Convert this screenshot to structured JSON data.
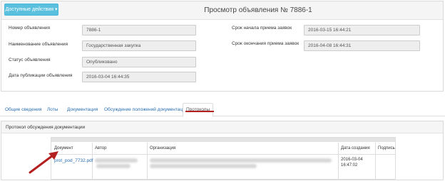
{
  "header": {
    "actions_button": "Доступные действия ▾",
    "title": "Просмотр объявления № 7886-1"
  },
  "fields": {
    "number": {
      "label": "Номер объявления",
      "value": "7886-1"
    },
    "name": {
      "label": "Наименование объявления",
      "value": "Государственная закупка"
    },
    "status": {
      "label": "Статус объявления",
      "value": "Опубликовано"
    },
    "publish_date": {
      "label": "Дата публикации объявления",
      "value": "2016-03-04 16:44:35"
    },
    "start_date": {
      "label": "Срок начала приема заявок",
      "value": "2016-03-15 16:44:21"
    },
    "end_date": {
      "label": "Срок окончания приема заявок",
      "value": "2016-04-08 16:44:31"
    }
  },
  "tabs": [
    {
      "label": "Общие сведения"
    },
    {
      "label": "Лоты"
    },
    {
      "label": "Документация"
    },
    {
      "label": "Обсуждение положений документации"
    },
    {
      "label": "Протоколы"
    }
  ],
  "protocol": {
    "panel_title": "Протокол обсуждения документации",
    "columns": [
      "Документ",
      "Автор",
      "Организация",
      "Дата создания",
      "Подпись"
    ],
    "rows": [
      {
        "document": "prot_pod_7732.pdf",
        "date_line1": "2016-03-04",
        "date_line2": "16:47:02"
      }
    ]
  },
  "colors": {
    "accent": "#5bc0de",
    "link": "#2a6fb0",
    "annotation": "#b41f1f"
  }
}
